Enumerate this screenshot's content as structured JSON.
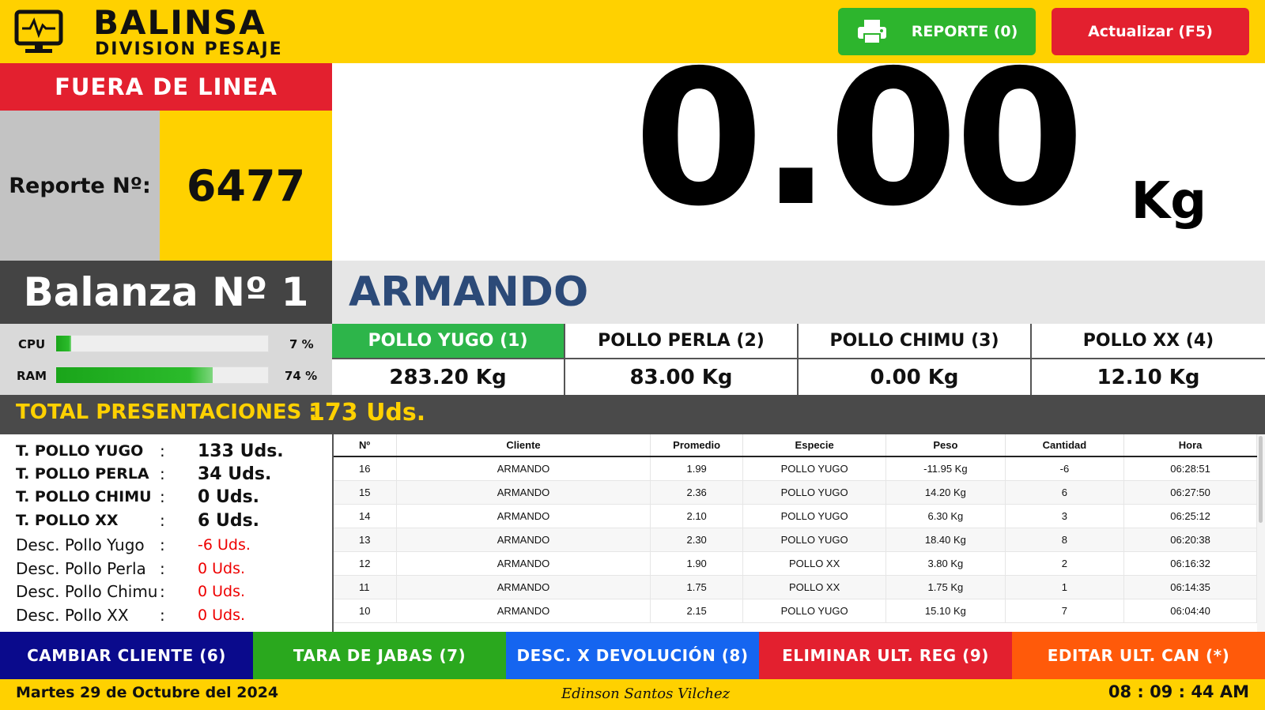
{
  "header": {
    "brand": "BALINSA",
    "brand_sub": "DIVISION PESAJE",
    "report_button": "REPORTE (0)",
    "refresh_button": "Actualizar (F5)"
  },
  "status": {
    "connection": "FUERA DE LINEA",
    "report_label": "Reporte Nº:",
    "report_number": "6477"
  },
  "scale": {
    "weight": "0.00",
    "unit": "Kg",
    "balanza": "Balanza Nº 1",
    "client": "ARMANDO"
  },
  "system": {
    "cpu_label": "CPU",
    "cpu_value": "7 %",
    "cpu_level": 0.07,
    "ram_label": "RAM",
    "ram_value": "74 %",
    "ram_level": 0.74
  },
  "species": [
    {
      "name": "POLLO YUGO (1)",
      "weight": "283.20 Kg",
      "active": true
    },
    {
      "name": "POLLO PERLA (2)",
      "weight": "83.00 Kg",
      "active": false
    },
    {
      "name": "POLLO CHIMU (3)",
      "weight": "0.00 Kg",
      "active": false
    },
    {
      "name": "POLLO XX (4)",
      "weight": "12.10 Kg",
      "active": false
    }
  ],
  "totals": {
    "label": "TOTAL PRESENTACIONES :",
    "value": "173 Uds."
  },
  "summary": [
    {
      "name": "T. POLLO YUGO",
      "colon": ":",
      "value": "133 Uds.",
      "kind": "bold"
    },
    {
      "name": "T. POLLO PERLA",
      "colon": ":",
      "value": "34 Uds.",
      "kind": "bold"
    },
    {
      "name": "T. POLLO CHIMU",
      "colon": ":",
      "value": "0 Uds.",
      "kind": "bold"
    },
    {
      "name": "T. POLLO XX",
      "colon": ":",
      "value": "6 Uds.",
      "kind": "bold"
    },
    {
      "name": "Desc. Pollo Yugo",
      "colon": ":",
      "value": "-6 Uds.",
      "kind": "red"
    },
    {
      "name": "Desc. Pollo Perla",
      "colon": ":",
      "value": "0 Uds.",
      "kind": "red"
    },
    {
      "name": "Desc. Pollo Chimu",
      "colon": ":",
      "value": "0 Uds.",
      "kind": "red"
    },
    {
      "name": "Desc. Pollo XX",
      "colon": ":",
      "value": "0 Uds.",
      "kind": "red"
    }
  ],
  "table": {
    "columns": [
      "Nº",
      "Cliente",
      "Promedio",
      "Especie",
      "Peso",
      "Cantidad",
      "Hora"
    ],
    "rows": [
      [
        "16",
        "ARMANDO",
        "1.99",
        "POLLO YUGO",
        "-11.95 Kg",
        "-6",
        "06:28:51"
      ],
      [
        "15",
        "ARMANDO",
        "2.36",
        "POLLO YUGO",
        "14.20 Kg",
        "6",
        "06:27:50"
      ],
      [
        "14",
        "ARMANDO",
        "2.10",
        "POLLO YUGO",
        "6.30 Kg",
        "3",
        "06:25:12"
      ],
      [
        "13",
        "ARMANDO",
        "2.30",
        "POLLO YUGO",
        "18.40 Kg",
        "8",
        "06:20:38"
      ],
      [
        "12",
        "ARMANDO",
        "1.90",
        "POLLO XX",
        "3.80 Kg",
        "2",
        "06:16:32"
      ],
      [
        "11",
        "ARMANDO",
        "1.75",
        "POLLO XX",
        "1.75 Kg",
        "1",
        "06:14:35"
      ],
      [
        "10",
        "ARMANDO",
        "2.15",
        "POLLO YUGO",
        "15.10 Kg",
        "7",
        "06:04:40"
      ]
    ]
  },
  "actions": [
    {
      "label": "CAMBIAR CLIENTE (6)",
      "color": "#0a0a8c"
    },
    {
      "label": "TARA DE JABAS (7)",
      "color": "#2aa81e"
    },
    {
      "label": "DESC. X DEVOLUCIÓN (8)",
      "color": "#1565f0"
    },
    {
      "label": "ELIMINAR ULT. REG (9)",
      "color": "#e3202f"
    },
    {
      "label": "EDITAR ULT. CAN (*)",
      "color": "#ff5a0a"
    }
  ],
  "footer": {
    "date": "Martes 29 de Octubre del 2024",
    "author": "Edinson Santos Vilchez",
    "time": "08 : 09 : 44 AM"
  },
  "colors": {
    "yellow": "#ffd100",
    "red": "#e3202f",
    "green": "#2db52d",
    "client_blue": "#2c4a78"
  }
}
